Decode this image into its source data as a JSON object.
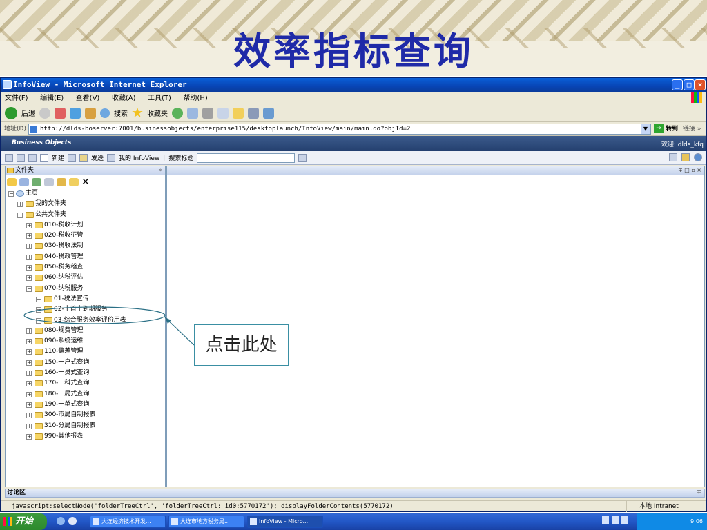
{
  "slide_title": "效率指标查询",
  "window": {
    "title": "InfoView - Microsoft Internet Explorer",
    "menu": [
      "文件(F)",
      "编辑(E)",
      "查看(V)",
      "收藏(A)",
      "工具(T)",
      "帮助(H)"
    ],
    "toolbar": {
      "back": "后退",
      "search": "搜索",
      "favorites": "收藏夹"
    },
    "address_label": "地址(D)",
    "address_url": "http://dlds-boserver:7001/businessobjects/enterprise115/desktoplaunch/InfoView/main/main.do?objId=2",
    "go_label": "转到",
    "links_label": "链接 »"
  },
  "bo": {
    "logo": "Business Objects",
    "welcome": "欢迎: dlds_kfq",
    "new_label": "新建",
    "send_label": "发送",
    "my_infoview": "我的 InfoView",
    "search_title": "搜索标题"
  },
  "left_panel": {
    "header": "文件夹",
    "home": "主页",
    "my_folders": "我的文件夹",
    "public_folders": "公共文件夹",
    "folders": [
      {
        "label": "010-税收计划",
        "level": 2,
        "expanded": false
      },
      {
        "label": "020-税收征管",
        "level": 2,
        "expanded": false
      },
      {
        "label": "030-税收法制",
        "level": 2,
        "expanded": false
      },
      {
        "label": "040-税政管理",
        "level": 2,
        "expanded": false
      },
      {
        "label": "050-税务稽查",
        "level": 2,
        "expanded": false
      },
      {
        "label": "060-纳税评估",
        "level": 2,
        "expanded": false
      },
      {
        "label": "070-纳税服务",
        "level": 2,
        "expanded": true
      },
      {
        "label": "01-税法宣传",
        "level": 3,
        "expanded": false
      },
      {
        "label": "02-十首十到期服务",
        "level": 3,
        "expanded": false
      },
      {
        "label": "03-综合服务效率评价用表",
        "level": 3,
        "expanded": false
      },
      {
        "label": "080-规费管理",
        "level": 2,
        "expanded": false
      },
      {
        "label": "090-系统运维",
        "level": 2,
        "expanded": false
      },
      {
        "label": "110-偏差管理",
        "level": 2,
        "expanded": false
      },
      {
        "label": "150-一户式查询",
        "level": 2,
        "expanded": false
      },
      {
        "label": "160-一员式查询",
        "level": 2,
        "expanded": false
      },
      {
        "label": "170-一科式查询",
        "level": 2,
        "expanded": false
      },
      {
        "label": "180-一局式查询",
        "level": 2,
        "expanded": false
      },
      {
        "label": "190-一单式查询",
        "level": 2,
        "expanded": false
      },
      {
        "label": "300-市局自制报表",
        "level": 2,
        "expanded": false
      },
      {
        "label": "310-分局自制报表",
        "level": 2,
        "expanded": false
      },
      {
        "label": "990-其他报表",
        "level": 2,
        "expanded": false
      }
    ]
  },
  "discussion_label": "讨论区",
  "status": {
    "text": "javascript:selectNode('folderTreeCtrl', 'folderTreeCtrl:_id0:5770172'); displayFolderContents(5770172)",
    "zone": "本地 Intranet"
  },
  "taskbar": {
    "start": "开始",
    "tasks": [
      "大连经济技术开发...",
      "大连市地方税务局...",
      "InfoView - Micro..."
    ],
    "clock": "9:06"
  },
  "callout": "点击此处"
}
